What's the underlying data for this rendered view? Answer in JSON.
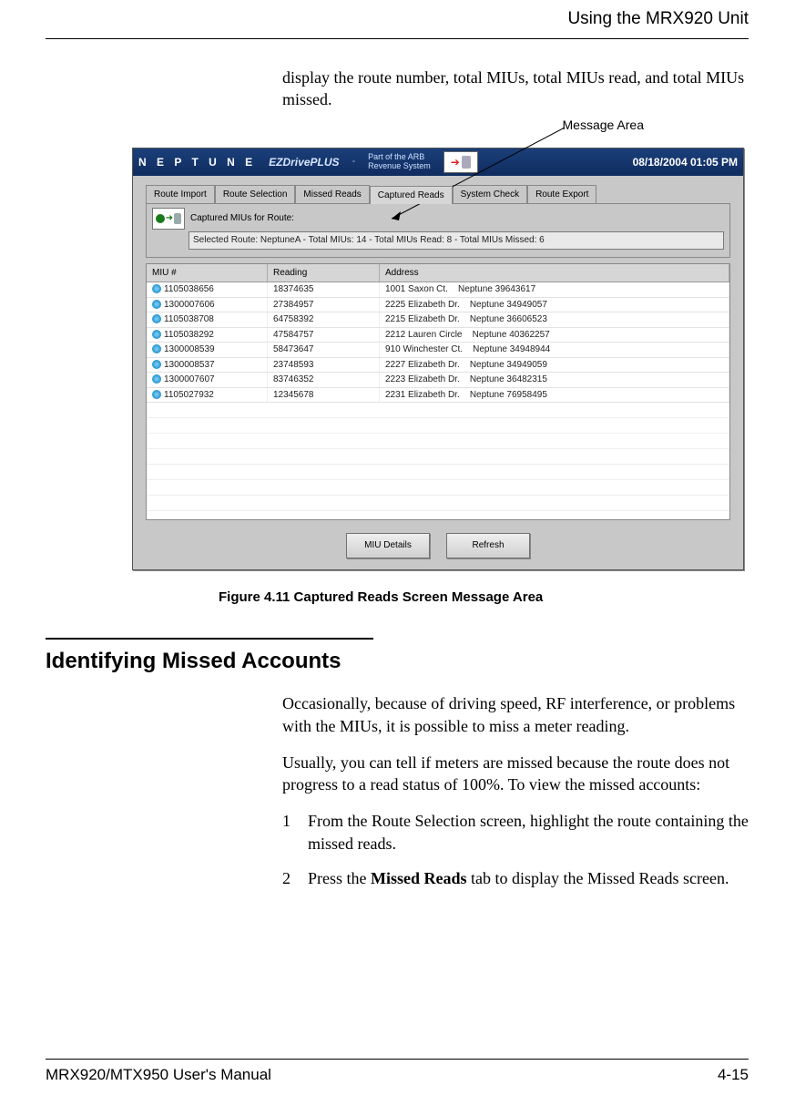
{
  "header": {
    "title": "Using the MRX920 Unit"
  },
  "intro": "display the route number, total MIUs, total MIUs read, and total MIUs missed.",
  "callout": {
    "label": "Message Area"
  },
  "screenshot": {
    "brand": "N E P T U N E",
    "subbrand": "EZDrivePLUS",
    "tagline1": "Part of the ARB",
    "tagline2": "Revenue System",
    "datetime": "08/18/2004 01:05 PM",
    "tabs": [
      "Route Import",
      "Route Selection",
      "Missed Reads",
      "Captured Reads",
      "System Check",
      "Route Export"
    ],
    "active_tab_index": 3,
    "msg_label": "Captured MIUs for Route:",
    "msg_value": "Selected Route: NeptuneA - Total MIUs: 14 - Total MIUs Read: 8 - Total MIUs Missed: 6",
    "columns": [
      "MIU #",
      "Reading",
      "Address"
    ],
    "rows": [
      {
        "miu": "1105038656",
        "reading": "18374635",
        "addr": "1001 Saxon Ct.",
        "city": "Neptune 39643617"
      },
      {
        "miu": "1300007606",
        "reading": "27384957",
        "addr": "2225 Elizabeth Dr.",
        "city": "Neptune 34949057"
      },
      {
        "miu": "1105038708",
        "reading": "64758392",
        "addr": "2215 Elizabeth Dr.",
        "city": "Neptune 36606523"
      },
      {
        "miu": "1105038292",
        "reading": "47584757",
        "addr": "2212 Lauren Circle",
        "city": "Neptune 40362257"
      },
      {
        "miu": "1300008539",
        "reading": "58473647",
        "addr": "910 Winchester Ct.",
        "city": "Neptune 34948944"
      },
      {
        "miu": "1300008537",
        "reading": "23748593",
        "addr": "2227 Elizabeth Dr.",
        "city": "Neptune 34949059"
      },
      {
        "miu": "1300007607",
        "reading": "83746352",
        "addr": "2223 Elizabeth Dr.",
        "city": "Neptune 36482315"
      },
      {
        "miu": "1105027932",
        "reading": "12345678",
        "addr": "2231 Elizabeth Dr.",
        "city": "Neptune 76958495"
      }
    ],
    "buttons": {
      "details": "MIU Details",
      "refresh": "Refresh"
    }
  },
  "figure_caption": "Figure 4.11   Captured Reads Screen Message Area",
  "section_heading": "Identifying Missed Accounts",
  "para1": "Occasionally, because of driving speed, RF interference, or problems with the MIUs, it is possible to miss a meter reading.",
  "para2": "Usually, you can tell if meters are missed because the route does not progress to a read status of 100%. To view the missed accounts:",
  "steps": [
    {
      "n": "1",
      "pre": "From the Route Selection screen, highlight the route containing the missed reads."
    },
    {
      "n": "2",
      "pre": "Press the ",
      "bold": "Missed Reads",
      "post": " tab to display the Missed Reads screen."
    }
  ],
  "footer": {
    "left": "MRX920/MTX950 User's Manual",
    "right": "4-15"
  }
}
